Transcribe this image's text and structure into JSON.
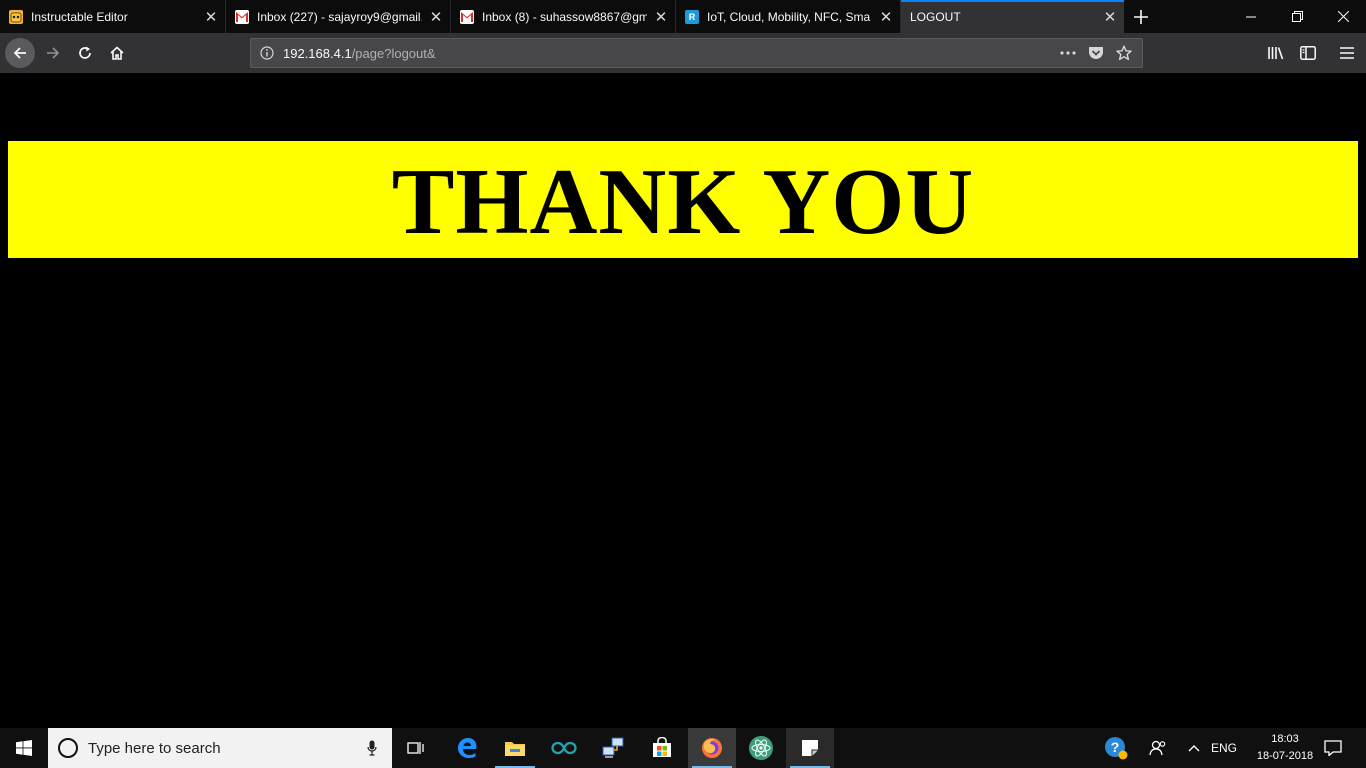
{
  "browser": {
    "tabs": [
      {
        "title": "Instructable Editor",
        "favicon": "instructables-robot-icon"
      },
      {
        "title": "Inbox (227) - sajayroy9@gmail.",
        "favicon": "gmail-icon"
      },
      {
        "title": "Inbox (8) - suhassow8867@gma",
        "favicon": "gmail-icon"
      },
      {
        "title": "IoT, Cloud, Mobility, NFC, Sma",
        "favicon": "r-logo-icon"
      },
      {
        "title": "LOGOUT",
        "favicon": "none"
      }
    ],
    "selected_tab": 4,
    "url": {
      "host": "192.168.4.1",
      "path": "/page?logout&"
    },
    "accent_color": "#0a84ff"
  },
  "page": {
    "heading": "THANK YOU",
    "banner_color": "#ffff00",
    "background_color": "#000000"
  },
  "taskbar": {
    "search_placeholder": "Type here to search",
    "pinned_apps": [
      "task-view-icon",
      "edge-icon",
      "file-explorer-icon",
      "arduino-icon",
      "network-tool-icon",
      "store-icon",
      "firefox-icon",
      "atom-icon",
      "sticky-notes-icon"
    ],
    "language": "ENG",
    "time": "18:03",
    "date": "18-07-2018"
  }
}
